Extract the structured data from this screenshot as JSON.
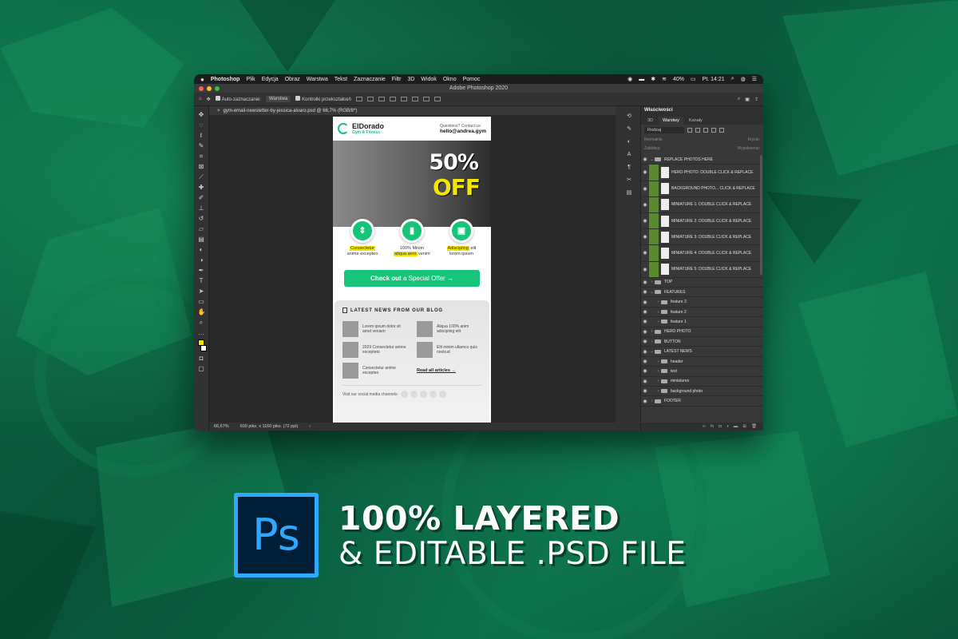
{
  "menubar": {
    "apple": "",
    "app": "Photoshop",
    "items": [
      "Plik",
      "Edycja",
      "Obraz",
      "Warstwa",
      "Tekst",
      "Zaznaczanie",
      "Filtr",
      "3D",
      "Widok",
      "Okno",
      "Pomoc"
    ],
    "battery": "40%",
    "clock": "Pt. 14:21"
  },
  "titlebar": {
    "title": "Adobe Photoshop 2020"
  },
  "options": {
    "auto_select": "Auto-zaznaczanie:",
    "auto_select_value": "Warstwa",
    "transform_controls": "Kontrolki przekształceń"
  },
  "document": {
    "tab": "gym-email-newsletter-by-jessica-alvaro.psd @ 66,7% (RGB/8*)",
    "zoom": "66,67%",
    "size": "600 piks. x 1160 piks. (72 ppi)"
  },
  "email": {
    "brand": "ElDorado",
    "brand_sub": "Gym & Fitness",
    "contact_q": "Questions? Contact us:",
    "contact_mail": "hello@andrea.gym",
    "hero_pct": "50%",
    "hero_off": "OFF",
    "features": [
      {
        "icon": "⇕",
        "line1_hl": "Consectetur",
        "line1_rest": "",
        "line2_hl": "",
        "line2_pre": "anime excepteo",
        "line2_rest": ""
      },
      {
        "icon": "▮",
        "line1_hl": "",
        "line1_rest": "100% Minim",
        "line2_hl": "aliqua aero",
        "line2_pre": "",
        "line2_rest": "venim"
      },
      {
        "icon": "▣",
        "line1_hl": "Adiscipling",
        "line1_rest": "elit",
        "line2_hl": "",
        "line2_pre": "lorem ipsum",
        "line2_rest": ""
      }
    ],
    "cta_bold": "Check out",
    "cta_rest": "a Special Offer →",
    "blog_title": "LATEST NEWS FROM OUR BLOG",
    "blog_items": [
      "Lorem ipsum dolor sit amet veniam",
      "Aliqua 100% anim adscipling elit",
      "2029 Consectetur anime excepteto",
      "Elit minim ullamco quis nostrud",
      "Consectetur anime excepteo"
    ],
    "read_all": "Read all articles →",
    "social": "Visit our social media channels:"
  },
  "layers_panel": {
    "header": "Właściwości",
    "tabs": [
      "3D",
      "Warstwy",
      "Kanały"
    ],
    "filter": "Rodzaj",
    "blend": "Normalnie",
    "opacity_label": "Krycie:",
    "lock_label": "Zablokuj:",
    "fill_label": "Wypełnienie:",
    "layers": [
      {
        "kind": "group",
        "level": 0,
        "open": true,
        "name": "REPLACE PHOTOS HERE"
      },
      {
        "kind": "img",
        "name": "HERO PHOTO: DOUBLE CLICK & REPLACE"
      },
      {
        "kind": "img",
        "name": "BACKGROUND PHOTO...  CLICK & REPLACE"
      },
      {
        "kind": "img",
        "name": "MINIATURE 1: DOUBLE CLICK & REPLACE"
      },
      {
        "kind": "img",
        "name": "MINIATURE 2: DOUBLE CLICK & REPLACE"
      },
      {
        "kind": "img",
        "name": "MINIATURE 3: DOUBLE CLICK & REPLACE"
      },
      {
        "kind": "img",
        "name": "MINIATURE 4: DOUBLE CLICK & REPLACE"
      },
      {
        "kind": "img",
        "name": "MINIATURE 5: DOUBLE CLICK & REPLACE"
      },
      {
        "kind": "group",
        "level": 0,
        "open": false,
        "name": "TOP"
      },
      {
        "kind": "group",
        "level": 0,
        "open": true,
        "name": "FEATURES"
      },
      {
        "kind": "group",
        "level": 1,
        "open": false,
        "name": "feature 3"
      },
      {
        "kind": "group",
        "level": 1,
        "open": false,
        "name": "feature 2"
      },
      {
        "kind": "group",
        "level": 1,
        "open": false,
        "name": "feature 1"
      },
      {
        "kind": "group",
        "level": 0,
        "open": false,
        "name": "HERO PHOTO"
      },
      {
        "kind": "group",
        "level": 0,
        "open": false,
        "name": "BUTTON"
      },
      {
        "kind": "group",
        "level": 0,
        "open": true,
        "name": "LATEST NEWS"
      },
      {
        "kind": "group",
        "level": 1,
        "open": false,
        "name": "header"
      },
      {
        "kind": "group",
        "level": 1,
        "open": false,
        "name": "text"
      },
      {
        "kind": "group",
        "level": 1,
        "open": false,
        "name": "miniatures"
      },
      {
        "kind": "group",
        "level": 1,
        "open": false,
        "name": "background photo"
      },
      {
        "kind": "group",
        "level": 0,
        "open": false,
        "name": "FOOTER"
      }
    ]
  },
  "promo": {
    "ps_logo": "Ps",
    "line1": "100% LAYERED",
    "line2": "& EDITABLE .PSD FILE"
  },
  "colors": {
    "accent_green": "#16c47a",
    "highlight_yellow": "#f5e600",
    "ps_blue": "#31a8ff",
    "ps_dark": "#001e36",
    "bg_green": "#0a5a3f"
  }
}
